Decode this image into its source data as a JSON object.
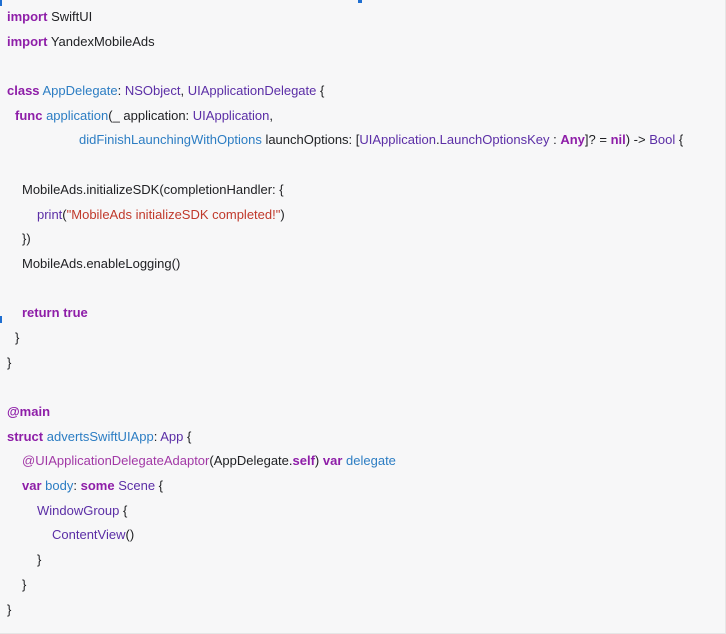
{
  "code": {
    "line_01": [
      {
        "t": "import",
        "c": "kw"
      },
      {
        "t": " SwiftUI",
        "c": "pl"
      }
    ],
    "line_02": [
      {
        "t": "import",
        "c": "kw"
      },
      {
        "t": " YandexMobileAds",
        "c": "pl"
      }
    ],
    "line_03": [],
    "line_04": [
      {
        "t": "class",
        "c": "kw"
      },
      {
        "t": " ",
        "c": "pl"
      },
      {
        "t": "AppDelegate",
        "c": "fn"
      },
      {
        "t": ": ",
        "c": "pl"
      },
      {
        "t": "NSObject",
        "c": "ty"
      },
      {
        "t": ", ",
        "c": "pl"
      },
      {
        "t": "UIApplicationDelegate",
        "c": "ty"
      },
      {
        "t": " {",
        "c": "pl"
      }
    ],
    "line_05": [
      {
        "t": "func",
        "c": "kw"
      },
      {
        "t": " ",
        "c": "pl"
      },
      {
        "t": "application",
        "c": "fn"
      },
      {
        "t": "(_ application: ",
        "c": "pl"
      },
      {
        "t": "UIApplication",
        "c": "ty"
      },
      {
        "t": ",",
        "c": "pl"
      }
    ],
    "line_06": [
      {
        "t": "didFinishLaunchingWithOptions",
        "c": "fn"
      },
      {
        "t": " launchOptions: [",
        "c": "pl"
      },
      {
        "t": "UIApplication",
        "c": "ty"
      },
      {
        "t": ".",
        "c": "pl"
      },
      {
        "t": "LaunchOptionsKey",
        "c": "ty"
      },
      {
        "t": " : ",
        "c": "pl"
      },
      {
        "t": "Any",
        "c": "kw"
      },
      {
        "t": "]? = ",
        "c": "pl"
      },
      {
        "t": "nil",
        "c": "kw"
      },
      {
        "t": ") -> ",
        "c": "pl"
      },
      {
        "t": "Bool",
        "c": "ty"
      },
      {
        "t": " {",
        "c": "pl"
      }
    ],
    "line_07": [],
    "line_08": [
      {
        "t": "MobileAds",
        "c": "pl"
      },
      {
        "t": ".",
        "c": "pl"
      },
      {
        "t": "initializeSDK",
        "c": "pl"
      },
      {
        "t": "(completionHandler: {",
        "c": "pl"
      }
    ],
    "line_09": [
      {
        "t": "print",
        "c": "ty"
      },
      {
        "t": "(",
        "c": "pl"
      },
      {
        "t": "\"MobileAds initializeSDK completed!\"",
        "c": "str"
      },
      {
        "t": ")",
        "c": "pl"
      }
    ],
    "line_10": [
      {
        "t": "})",
        "c": "pl"
      }
    ],
    "line_11": [
      {
        "t": "MobileAds",
        "c": "pl"
      },
      {
        "t": ".",
        "c": "pl"
      },
      {
        "t": "enableLogging",
        "c": "pl"
      },
      {
        "t": "()",
        "c": "pl"
      }
    ],
    "line_12": [],
    "line_13": [
      {
        "t": "return",
        "c": "kw"
      },
      {
        "t": " ",
        "c": "pl"
      },
      {
        "t": "true",
        "c": "kw"
      }
    ],
    "line_14": [
      {
        "t": "}",
        "c": "pl"
      }
    ],
    "line_15": [
      {
        "t": "}",
        "c": "pl"
      }
    ],
    "line_16": [],
    "line_17": [
      {
        "t": "@main",
        "c": "kw"
      }
    ],
    "line_18": [
      {
        "t": "struct",
        "c": "kw"
      },
      {
        "t": " ",
        "c": "pl"
      },
      {
        "t": "advertsSwiftUIApp",
        "c": "fn"
      },
      {
        "t": ": ",
        "c": "pl"
      },
      {
        "t": "App",
        "c": "ty"
      },
      {
        "t": " {",
        "c": "pl"
      }
    ],
    "line_19": [
      {
        "t": "@UIApplicationDelegateAdaptor",
        "c": "at"
      },
      {
        "t": "(",
        "c": "pl"
      },
      {
        "t": "AppDelegate",
        "c": "pl"
      },
      {
        "t": ".",
        "c": "pl"
      },
      {
        "t": "self",
        "c": "kw"
      },
      {
        "t": ") ",
        "c": "pl"
      },
      {
        "t": "var",
        "c": "kw"
      },
      {
        "t": " ",
        "c": "pl"
      },
      {
        "t": "delegate",
        "c": "fn"
      }
    ],
    "line_20": [
      {
        "t": "var",
        "c": "kw"
      },
      {
        "t": " ",
        "c": "pl"
      },
      {
        "t": "body",
        "c": "fn"
      },
      {
        "t": ": ",
        "c": "pl"
      },
      {
        "t": "some",
        "c": "kw"
      },
      {
        "t": " ",
        "c": "pl"
      },
      {
        "t": "Scene",
        "c": "ty"
      },
      {
        "t": " {",
        "c": "pl"
      }
    ],
    "line_21": [
      {
        "t": "WindowGroup",
        "c": "ty"
      },
      {
        "t": " {",
        "c": "pl"
      }
    ],
    "line_22": [
      {
        "t": "ContentView",
        "c": "ty"
      },
      {
        "t": "()",
        "c": "pl"
      }
    ],
    "line_23": [
      {
        "t": "}",
        "c": "pl"
      }
    ],
    "line_24": [
      {
        "t": "}",
        "c": "pl"
      }
    ],
    "line_25": [
      {
        "t": "}",
        "c": "pl"
      }
    ]
  }
}
